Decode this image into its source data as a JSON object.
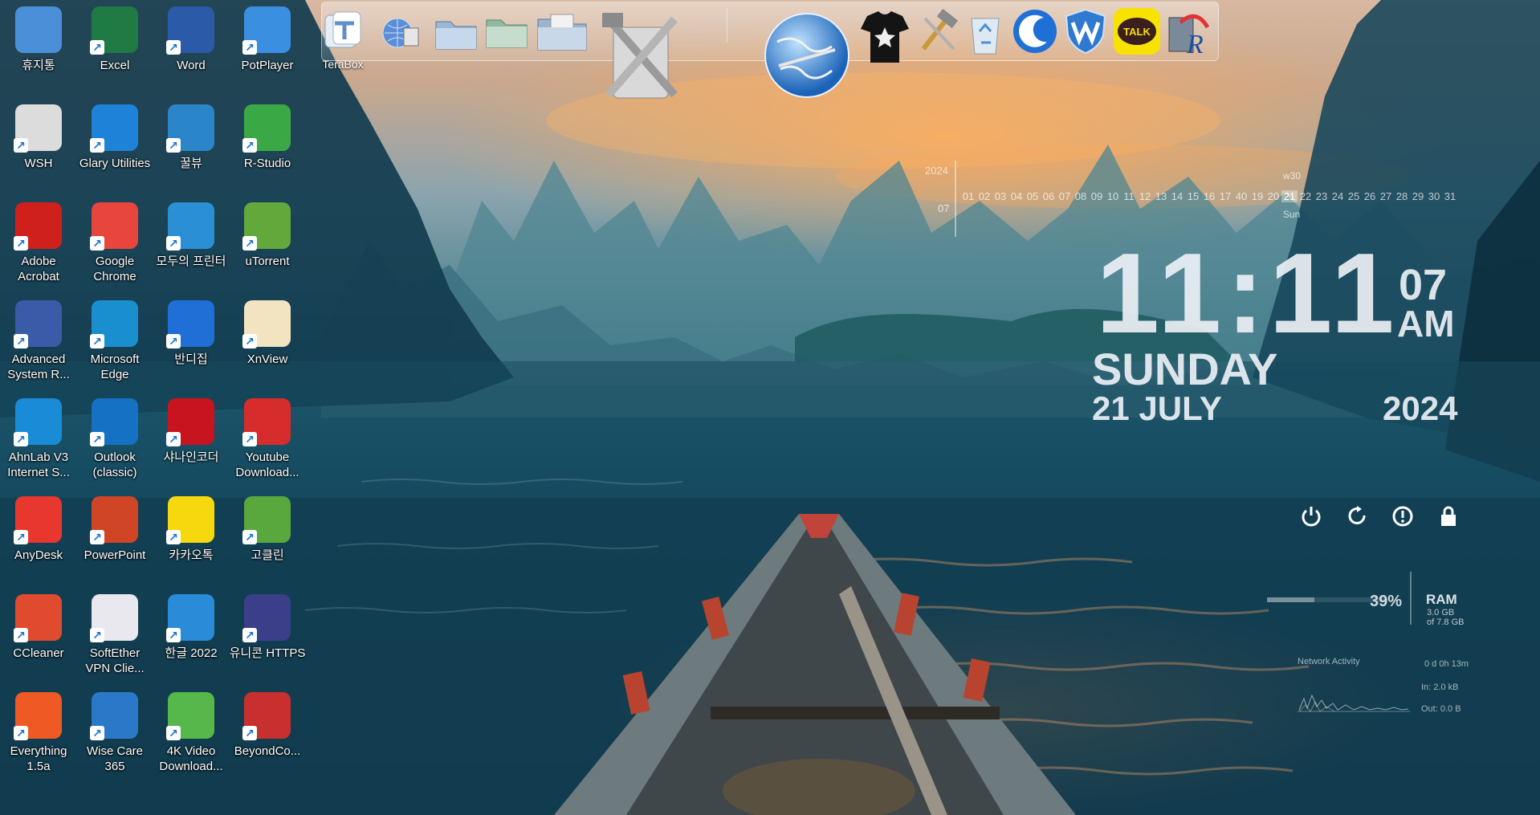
{
  "desktop": {
    "icons": [
      {
        "label": "휴지통",
        "icon": "recycle-bin-icon",
        "color": "#4a90d9"
      },
      {
        "label": "Excel",
        "icon": "excel-icon",
        "color": "#1f7a43"
      },
      {
        "label": "Word",
        "icon": "word-icon",
        "color": "#2b5aa8"
      },
      {
        "label": "PotPlayer",
        "icon": "potplayer-icon",
        "color": "#3b8fe0"
      },
      {
        "label": "WSH",
        "icon": "document-icon",
        "color": "#dcdcdc"
      },
      {
        "label": "Glary Utilities",
        "icon": "glary-utilities-icon",
        "color": "#1e82d8"
      },
      {
        "label": "꿀뷰",
        "icon": "honeyview-icon",
        "color": "#2a86c8"
      },
      {
        "label": "R-Studio",
        "icon": "r-studio-icon",
        "color": "#3aa844"
      },
      {
        "label": "Adobe Acrobat",
        "icon": "acrobat-icon",
        "color": "#d0201c"
      },
      {
        "label": "Google Chrome",
        "icon": "chrome-icon",
        "color": "#e8453c"
      },
      {
        "label": "모두의 프린터",
        "icon": "printer-icon",
        "color": "#2b8fd6"
      },
      {
        "label": "uTorrent",
        "icon": "utorrent-icon",
        "color": "#63a83b"
      },
      {
        "label": "Advanced System R...",
        "icon": "advanced-system-repair-icon",
        "color": "#3a5ba8"
      },
      {
        "label": "Microsoft Edge",
        "icon": "edge-icon",
        "color": "#1a8fcf"
      },
      {
        "label": "반디집",
        "icon": "bandizip-icon",
        "color": "#1f6fd6"
      },
      {
        "label": "XnView",
        "icon": "xnview-icon",
        "color": "#f2e4c0"
      },
      {
        "label": "AhnLab V3 Internet S...",
        "icon": "ahnlab-v3-icon",
        "color": "#1a8bd6"
      },
      {
        "label": "Outlook (classic)",
        "icon": "outlook-icon",
        "color": "#1471c4"
      },
      {
        "label": "샤나인코더",
        "icon": "shana-encoder-icon",
        "color": "#c8141e"
      },
      {
        "label": "Youtube Download...",
        "icon": "youtube-downloader-icon",
        "color": "#d62c2c"
      },
      {
        "label": "AnyDesk",
        "icon": "anydesk-icon",
        "color": "#e8372e"
      },
      {
        "label": "PowerPoint",
        "icon": "powerpoint-icon",
        "color": "#d04526"
      },
      {
        "label": "카카오톡",
        "icon": "kakaotalk-icon",
        "color": "#f5d80d"
      },
      {
        "label": "고클린",
        "icon": "goclean-icon",
        "color": "#58a83e"
      },
      {
        "label": "CCleaner",
        "icon": "ccleaner-icon",
        "color": "#e04a2e"
      },
      {
        "label": "SoftEther VPN Clie...",
        "icon": "softether-vpn-icon",
        "color": "#e8e8ee"
      },
      {
        "label": "한글 2022",
        "icon": "hangul-icon",
        "color": "#2a8bd8"
      },
      {
        "label": "유니콘 HTTPS",
        "icon": "unicorn-https-icon",
        "color": "#3b3f8a"
      },
      {
        "label": "Everything 1.5a",
        "icon": "everything-icon",
        "color": "#ef5a24"
      },
      {
        "label": "Wise Care 365",
        "icon": "wise-care-icon",
        "color": "#2c78c8"
      },
      {
        "label": "4K Video Download...",
        "icon": "4k-video-downloader-icon",
        "color": "#56b84a"
      },
      {
        "label": "BeyondCo...",
        "icon": "beyond-compare-icon",
        "color": "#c83030"
      }
    ]
  },
  "dock": {
    "terabox_label": "TeraBox",
    "items": [
      {
        "icon": "terabox-icon"
      },
      {
        "icon": "globe-network-icon"
      },
      {
        "icon": "folder-icon"
      },
      {
        "icon": "folder-green-icon"
      },
      {
        "icon": "folder-documents-icon"
      },
      {
        "icon": "tools-icon"
      },
      {
        "icon": "globe-icon"
      },
      {
        "icon": "tshirt-icon"
      },
      {
        "icon": "hammer-icon"
      },
      {
        "icon": "recycle-bin-icon"
      },
      {
        "icon": "glary-utilities-icon"
      },
      {
        "icon": "wise-care-icon"
      },
      {
        "icon": "kakaotalk-icon"
      },
      {
        "icon": "r-studio-icon"
      }
    ],
    "kakao_text": "TALK"
  },
  "calendar": {
    "year": "2024",
    "month": "07",
    "week": "w30",
    "today_dow": "Sun",
    "days": [
      "01",
      "02",
      "03",
      "04",
      "05",
      "06",
      "07",
      "08",
      "09",
      "10",
      "11",
      "12",
      "13",
      "14",
      "15",
      "16",
      "17",
      "40",
      "19",
      "20",
      "21",
      "22",
      "23",
      "24",
      "25",
      "26",
      "27",
      "28",
      "29",
      "30",
      "31"
    ],
    "today": "21"
  },
  "clock": {
    "time": "11:11",
    "seconds": "07",
    "ampm": "AM",
    "day": "SUNDAY",
    "date": "21 JULY",
    "year": "2024"
  },
  "power": [
    {
      "icon": "power-icon"
    },
    {
      "icon": "restart-icon"
    },
    {
      "icon": "logoff-icon"
    },
    {
      "icon": "lock-icon"
    }
  ],
  "system": {
    "ram_percent_text": "39%",
    "ram_fraction": 0.39,
    "ram_label": "RAM",
    "ram_used": "3.0 GB",
    "ram_total": "of 7.8 GB",
    "network_title": "Network Activity",
    "uptime": "0 d 0h 13m",
    "net_in": "In: 2.0 kB",
    "net_out": "Out: 0.0 B"
  }
}
